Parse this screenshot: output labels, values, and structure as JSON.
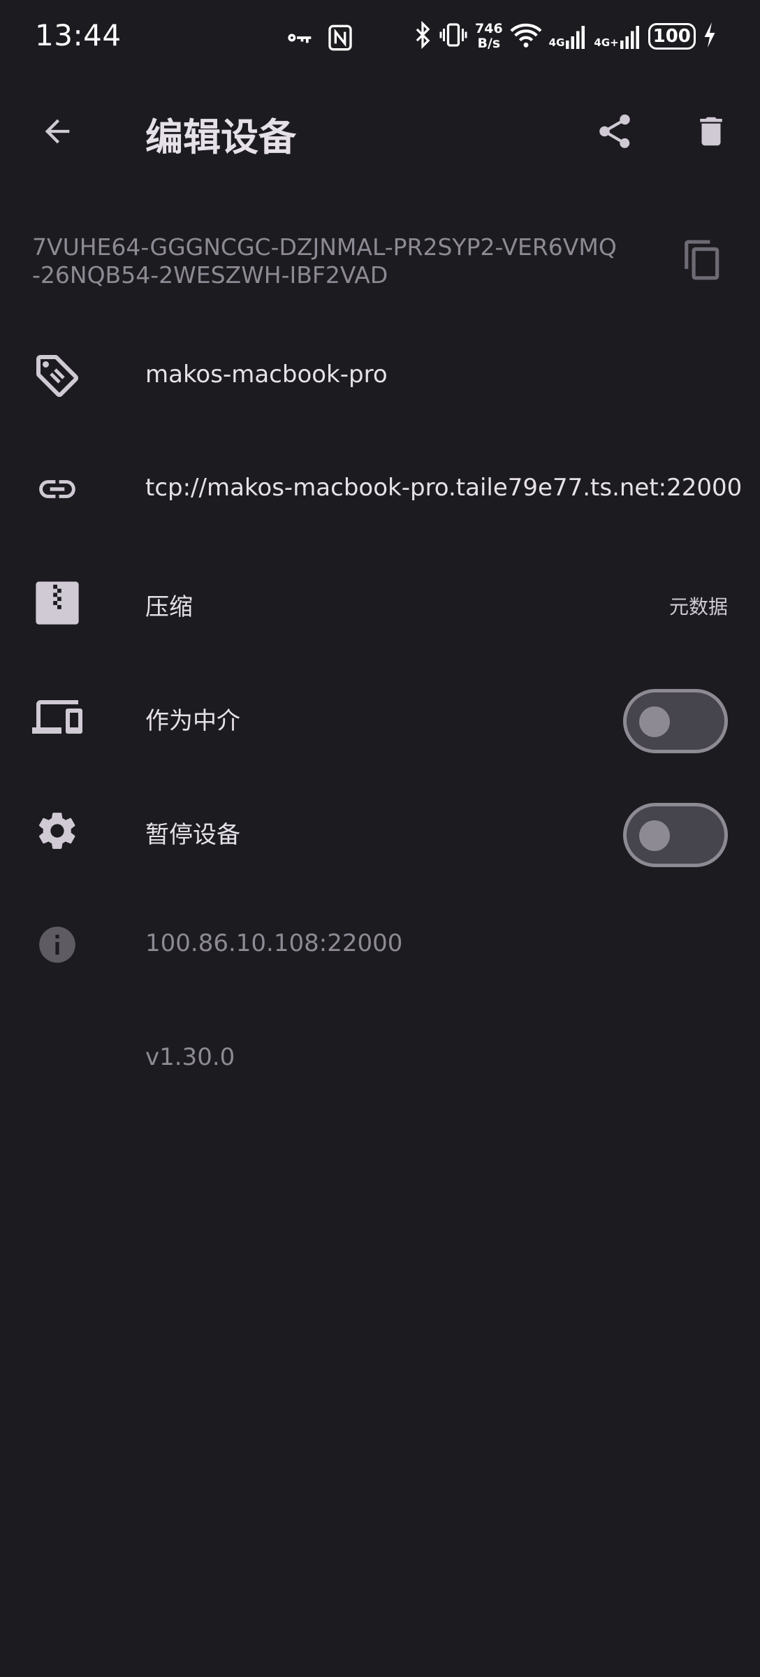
{
  "status_bar": {
    "time": "13:44",
    "net_speed_value": "746",
    "net_speed_unit": "B/s",
    "sim1_label": "4G",
    "sim2_label": "4G+",
    "battery": "100"
  },
  "app_bar": {
    "title": "编辑设备",
    "back_icon": "arrow-left-icon",
    "share_icon": "share-icon",
    "delete_icon": "trash-icon"
  },
  "device": {
    "id_line1": "7VUHE64-GGGNCGC-DZJNMAL-PR2SYP2-VER6VMQ",
    "id_line2": "-26NQB54-2WESZWH-IBF2VAD",
    "copy_icon": "copy-icon"
  },
  "rows": {
    "name": {
      "icon": "tag-icon",
      "value": "makos-macbook-pro"
    },
    "address": {
      "icon": "link-icon",
      "value": "tcp://makos-macbook-pro.taile79e77.ts.net:22000"
    },
    "compression": {
      "icon": "zip-icon",
      "label": "压缩",
      "value": "元数据"
    },
    "introducer": {
      "icon": "devices-icon",
      "label": "作为中介",
      "enabled": false
    },
    "pause": {
      "icon": "gear-icon",
      "label": "暂停设备",
      "enabled": false
    },
    "connection": {
      "icon": "info-icon",
      "value": "100.86.10.108:22000"
    },
    "version": {
      "value": "v1.30.0"
    }
  },
  "colors": {
    "background": "#1c1b20",
    "primary_text": "#e6e1e8",
    "secondary_text": "#8e8a93"
  }
}
